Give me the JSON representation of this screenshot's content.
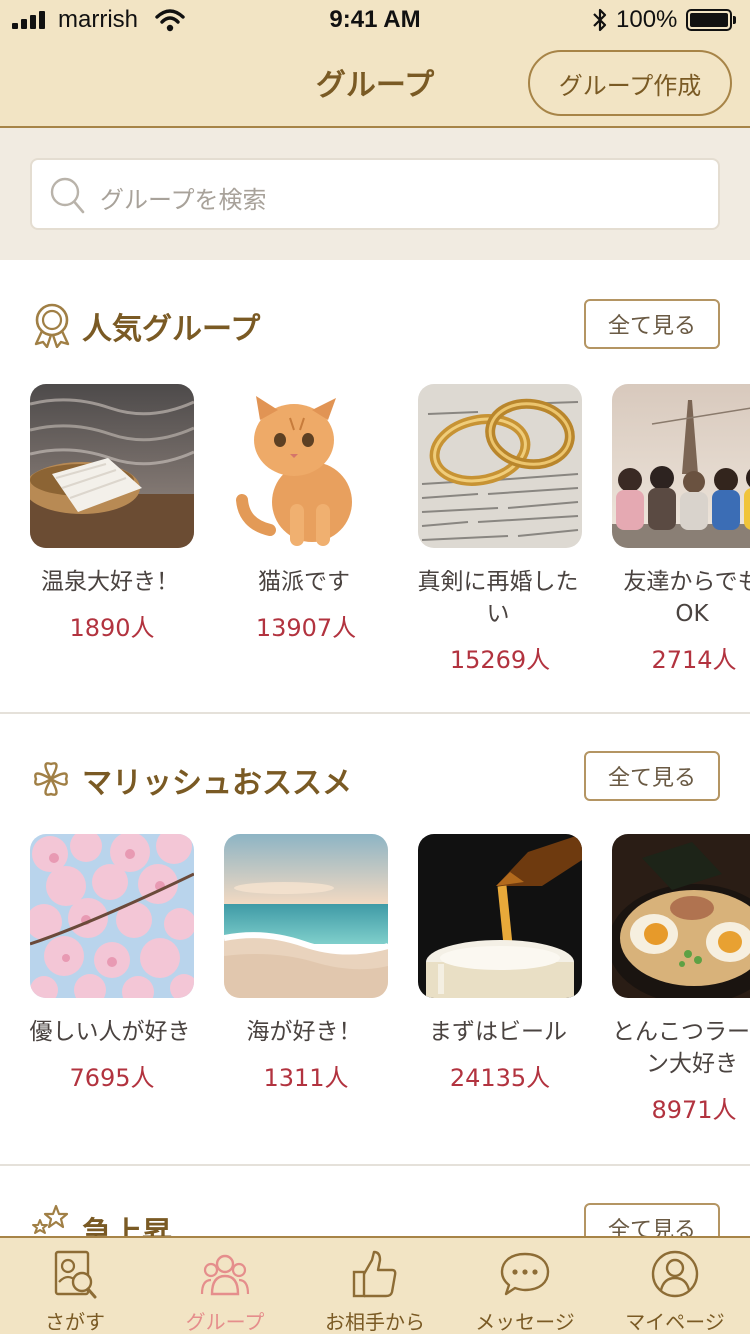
{
  "status": {
    "carrier": "marrish",
    "time": "9:41 AM",
    "battery": "100%"
  },
  "header": {
    "title": "グループ",
    "create_button": "グループ作成"
  },
  "search": {
    "placeholder": "グループを検索"
  },
  "sections": [
    {
      "title": "人気グループ",
      "icon": "award-icon",
      "see_all": "全て見る",
      "groups": [
        {
          "name": "温泉大好き！",
          "count": "1890人",
          "image": "hot-spring-towel"
        },
        {
          "name": "猫派です",
          "count": "13907人",
          "image": "orange-kitten"
        },
        {
          "name": "真剣に再婚したい",
          "count": "15269人",
          "image": "wedding-rings"
        },
        {
          "name": "友達からでもOK",
          "count": "2714人",
          "image": "friends-group"
        }
      ]
    },
    {
      "title": "マリッシュおススメ",
      "icon": "clover-icon",
      "see_all": "全て見る",
      "groups": [
        {
          "name": "優しい人が好き",
          "count": "7695人",
          "image": "cherry-blossoms"
        },
        {
          "name": "海が好き！",
          "count": "1311人",
          "image": "beach"
        },
        {
          "name": "まずはビール",
          "count": "24135人",
          "image": "beer"
        },
        {
          "name": "とんこつラーメン大好き",
          "count": "8971人",
          "image": "ramen"
        }
      ]
    },
    {
      "title": "急上昇",
      "icon": "stars-icon",
      "see_all": "全て見る"
    }
  ],
  "tabs": [
    {
      "label": "さがす",
      "icon": "search-profile-icon",
      "active": false
    },
    {
      "label": "グループ",
      "icon": "group-icon",
      "active": true
    },
    {
      "label": "お相手から",
      "icon": "thumbs-up-icon",
      "active": false
    },
    {
      "label": "メッセージ",
      "icon": "message-icon",
      "active": false
    },
    {
      "label": "マイページ",
      "icon": "user-icon",
      "active": false
    }
  ],
  "colors": {
    "accent": "#7a5a24",
    "header_bg": "#f2e4c4",
    "count_red": "#b2333f",
    "active_tab": "#e58e8c"
  }
}
